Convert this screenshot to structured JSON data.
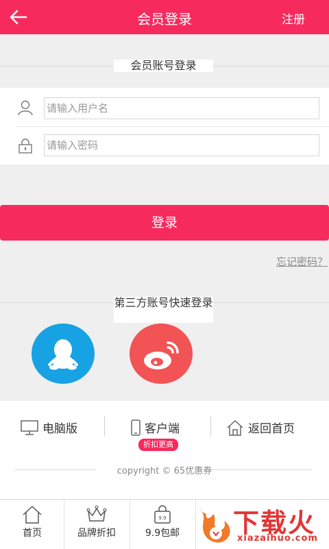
{
  "header": {
    "title": "会员登录",
    "register_label": "注册"
  },
  "member_section": {
    "label": "会员账号登录"
  },
  "form": {
    "username_placeholder": "请输入用户名",
    "password_placeholder": "请输入密码"
  },
  "login_button": "登录",
  "forgot_password": "忘记密码？",
  "third_party": {
    "label": "第三方账号快速登录",
    "providers": [
      "qq-icon",
      "weibo-icon"
    ]
  },
  "footer": {
    "links": [
      {
        "icon": "monitor-icon",
        "label": "电脑版"
      },
      {
        "icon": "phone-icon",
        "label": "客户端"
      },
      {
        "icon": "home-icon",
        "label": "返回首页"
      }
    ],
    "badge": "折扣更高",
    "copyright": "copyright © 65优惠券"
  },
  "tabbar": [
    {
      "icon": "home-icon",
      "label": "首页"
    },
    {
      "icon": "crown-icon",
      "label": "品牌折扣"
    },
    {
      "icon": "bag-icon",
      "label": "9.9包邮"
    }
  ],
  "watermark": {
    "text": "下载火",
    "sub": "xiazaihuo.com"
  },
  "colors": {
    "accent": "#f72a5e",
    "qq": "#17a2e3",
    "weibo": "#f25355"
  }
}
